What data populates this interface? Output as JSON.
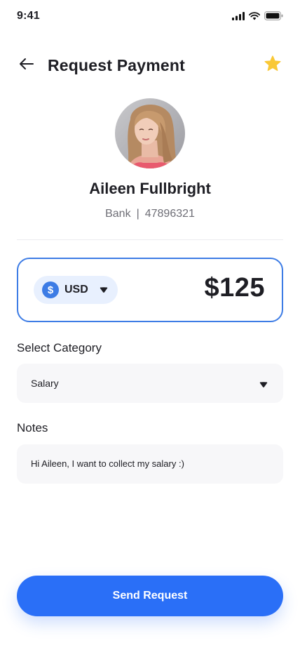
{
  "status_bar": {
    "time": "9:41"
  },
  "header": {
    "title": "Request Payment"
  },
  "contact": {
    "name": "Aileen Fullbright",
    "account_type": "Bank",
    "separator": "|",
    "account_number": "47896321"
  },
  "amount": {
    "currency_symbol": "$",
    "currency_code": "USD",
    "value": "$125"
  },
  "category": {
    "label": "Select Category",
    "selected": "Salary"
  },
  "notes": {
    "label": "Notes",
    "value": "Hi Aileen, I want to collect my salary :)"
  },
  "actions": {
    "send_label": "Send Request"
  },
  "colors": {
    "accent": "#2a6ff7",
    "card_border": "#3d7ce5",
    "pill_bg": "#e8f0fe",
    "star": "#f9c836",
    "field_bg": "#f7f7f9"
  }
}
